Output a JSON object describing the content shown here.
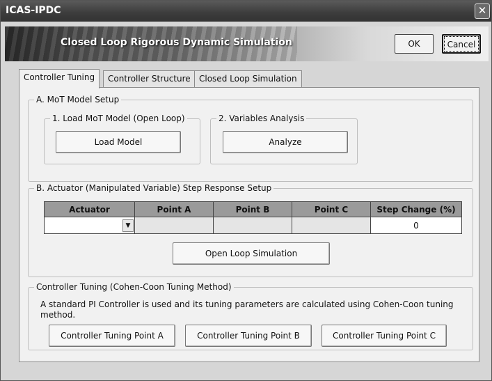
{
  "window": {
    "title": "ICAS-IPDC",
    "close_glyph": "✕"
  },
  "banner": {
    "subtitle": "Closed Loop Rigorous Dynamic Simulation"
  },
  "dialog_buttons": {
    "ok": "OK",
    "cancel": "Cancel"
  },
  "tabs": [
    {
      "label": "Controller Tuning",
      "active": true
    },
    {
      "label": "Controller Structure",
      "active": false
    },
    {
      "label": "Closed Loop Simulation",
      "active": false
    }
  ],
  "section_a": {
    "title": "A. MoT Model Setup",
    "load_group": {
      "title": "1. Load MoT Model (Open Loop)",
      "button": "Load Model"
    },
    "analysis_group": {
      "title": "2. Variables Analysis",
      "button": "Analyze"
    }
  },
  "section_b": {
    "title": "B. Actuator (Manipulated Variable) Step Response Setup",
    "columns": [
      "Actuator",
      "Point A",
      "Point B",
      "Point C",
      "Step Change (%)"
    ],
    "row": {
      "actuator": "",
      "point_a": "",
      "point_b": "",
      "point_c": "",
      "step_change": "0"
    },
    "button": "Open Loop Simulation"
  },
  "section_c": {
    "title": "Controller Tuning (Cohen-Coon Tuning Method)",
    "description": "A standard PI Controller is used and its tuning parameters are calculated using Cohen-Coon tuning method.",
    "buttons": [
      "Controller Tuning Point A",
      "Controller Tuning Point B",
      "Controller Tuning Point C"
    ]
  }
}
